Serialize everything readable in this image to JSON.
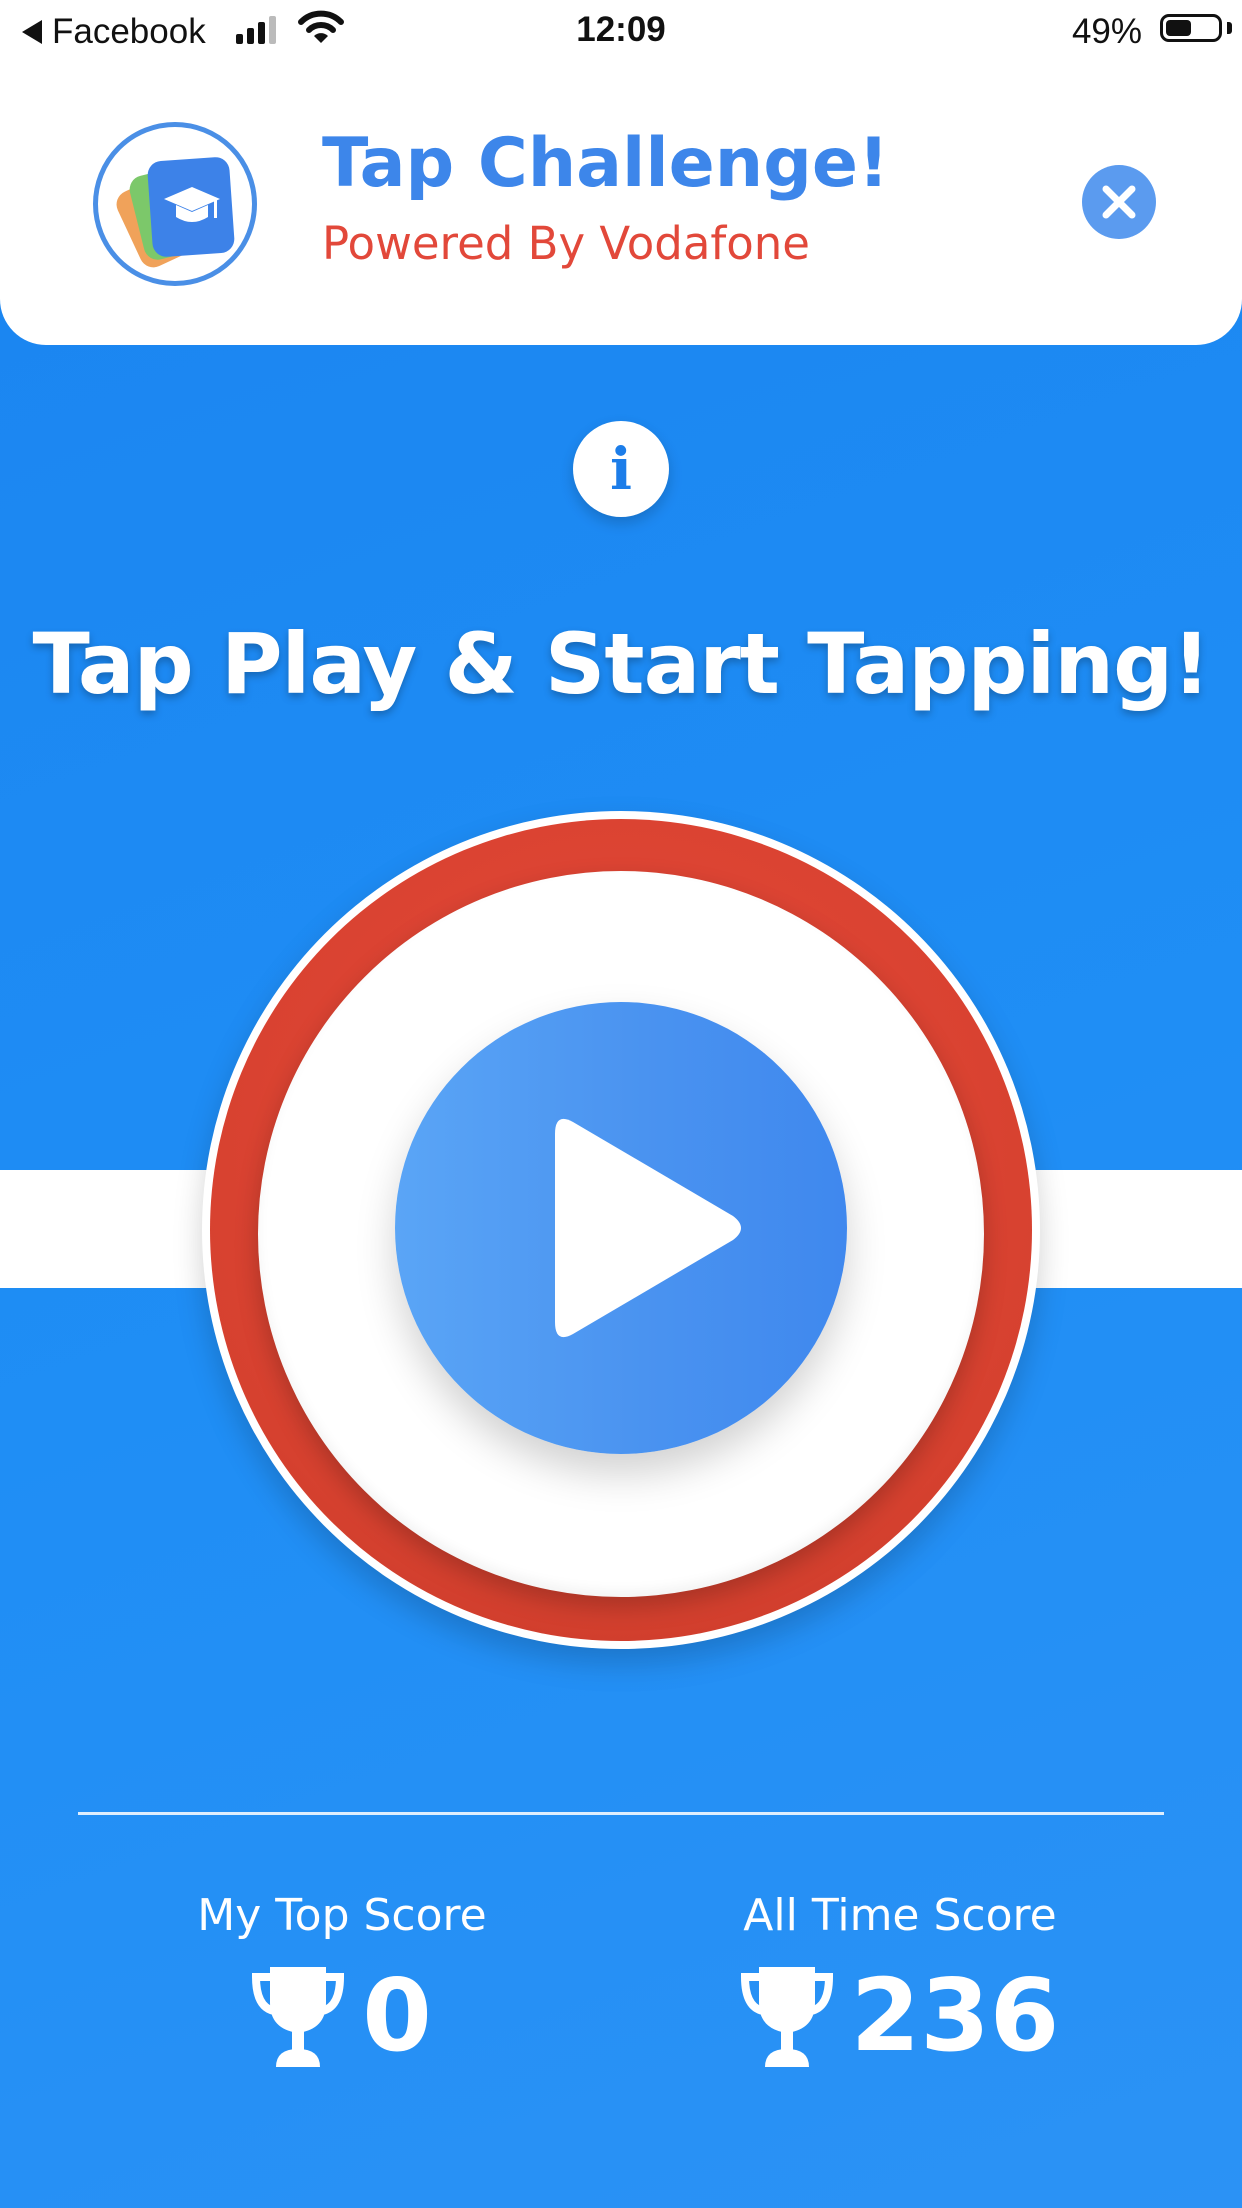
{
  "status_bar": {
    "back_label": "Facebook",
    "time": "12:09",
    "battery_percent": "49%",
    "battery_level": 0.49,
    "signal_bars": 3
  },
  "header": {
    "title": "Tap Challenge!",
    "subtitle": "Powered By Vodafone",
    "logo_icon": "graduation-cap-cards-icon",
    "close_icon": "close-icon"
  },
  "main": {
    "info_icon": "info-icon",
    "info_glyph": "i",
    "instruction": "Tap Play & Start Tapping!",
    "play_icon": "play-icon"
  },
  "scores": {
    "my_top_label": "My Top Score",
    "my_top_value": "0",
    "all_time_label": "All Time Score",
    "all_time_value": "236",
    "trophy_icon": "trophy-icon"
  },
  "colors": {
    "background": "#1f8ef5",
    "title_blue": "#3d86ea",
    "subtitle_red": "#e2483a",
    "ring_red": "#d6412f",
    "play_blue": "#4a93f0"
  }
}
